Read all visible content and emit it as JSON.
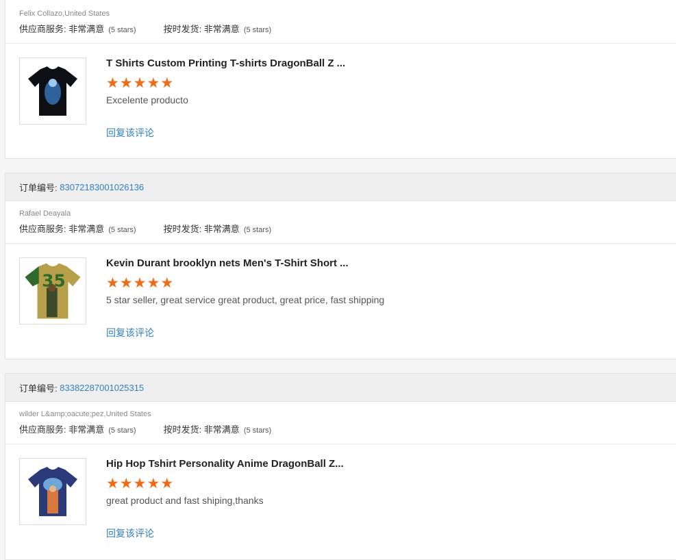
{
  "reviews": [
    {
      "order_label": "",
      "order_number": "",
      "buyer": "Felix Collazo,United States",
      "supplier_service_label": "供应商服务: 非常满意",
      "supplier_service_stars": "(5 stars)",
      "shipping_label": "按时发货: 非常满意",
      "shipping_stars": "(5 stars)",
      "product_title": "T Shirts Custom Printing T-shirts DragonBall Z ...",
      "rating": 5,
      "review_text": "Excelente producto",
      "reply_label": "回复该评论",
      "thumb_colors": {
        "shirt": "#0d0f14",
        "accent": "#3f86d6"
      }
    },
    {
      "order_label": "订单编号:",
      "order_number": "83072183001026136",
      "buyer": "Rafael Deayala",
      "supplier_service_label": "供应商服务: 非常满意",
      "supplier_service_stars": "(5 stars)",
      "shipping_label": "按时发货: 非常满意",
      "shipping_stars": "(5 stars)",
      "product_title": "Kevin Durant brooklyn nets Men's T-Shirt Short ...",
      "rating": 5,
      "review_text": "5 star seller, great service great product, great price, fast shipping",
      "reply_label": "回复该评论",
      "thumb_colors": {
        "shirt": "#b8a04a",
        "accent": "#2e6b2a"
      }
    },
    {
      "order_label": "订单编号:",
      "order_number": "83382287001025315",
      "buyer": "wilder L&amp;oacute;pez,United States",
      "supplier_service_label": "供应商服务: 非常满意",
      "supplier_service_stars": "(5 stars)",
      "shipping_label": "按时发货: 非常满意",
      "shipping_stars": "(5 stars)",
      "product_title": "Hip Hop Tshirt Personality Anime DragonBall Z...",
      "rating": 5,
      "review_text": "great product and fast shiping,thanks",
      "reply_label": "回复该评论",
      "thumb_colors": {
        "shirt": "#2a3a7a",
        "accent": "#d7773a"
      }
    }
  ]
}
